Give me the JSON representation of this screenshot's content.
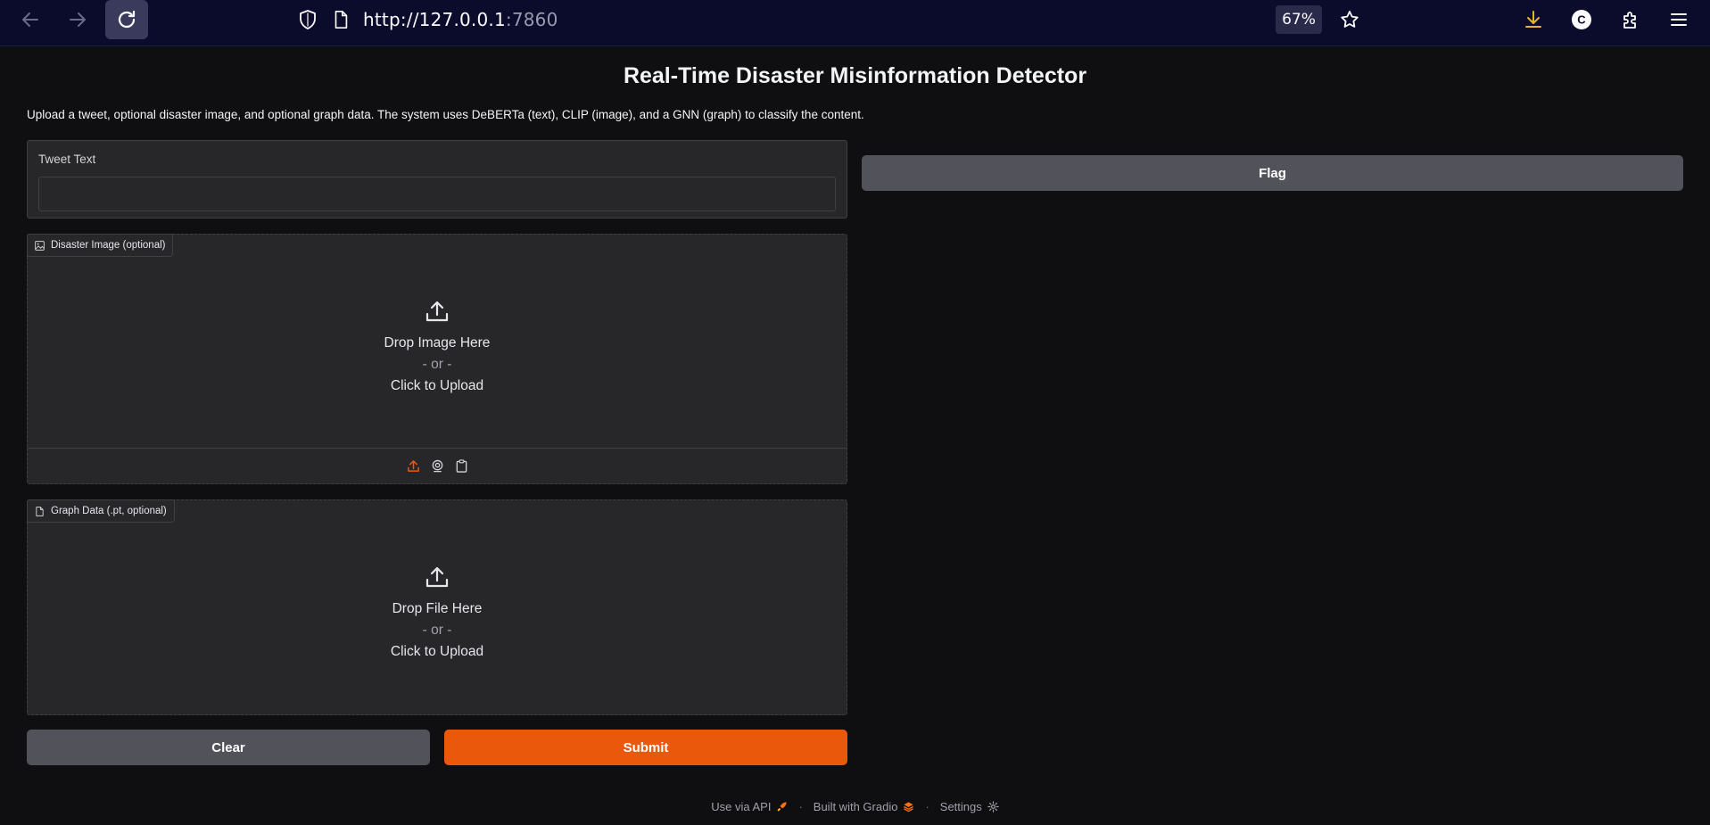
{
  "browser": {
    "url_host": "http://127.0.0.1",
    "url_port": ":7860",
    "zoom": "67%",
    "account_initial": "C"
  },
  "app": {
    "title": "Real-Time Disaster Misinformation Detector",
    "description": "Upload a tweet, optional disaster image, and optional graph data. The system uses DeBERTa (text), CLIP (image), and a GNN (graph) to classify the content.",
    "tweet": {
      "label": "Tweet Text",
      "value": "",
      "placeholder": ""
    },
    "image_upload": {
      "label": "Disaster Image (optional)",
      "drop_text": "Drop Image Here",
      "or_text": "- or -",
      "click_text": "Click to Upload",
      "sources": [
        "upload-icon",
        "webcam-icon",
        "clipboard-icon"
      ]
    },
    "file_upload": {
      "label": "Graph Data (.pt, optional)",
      "drop_text": "Drop File Here",
      "or_text": "- or -",
      "click_text": "Click to Upload"
    },
    "buttons": {
      "clear": "Clear",
      "submit": "Submit",
      "flag": "Flag"
    },
    "footer": {
      "api": "Use via API",
      "built": "Built with Gradio",
      "settings": "Settings"
    }
  },
  "colors": {
    "accent": "#ea580c",
    "chrome_bg": "#0b0b2c",
    "page_bg": "#0f0f11",
    "panel_bg": "#27272a"
  }
}
